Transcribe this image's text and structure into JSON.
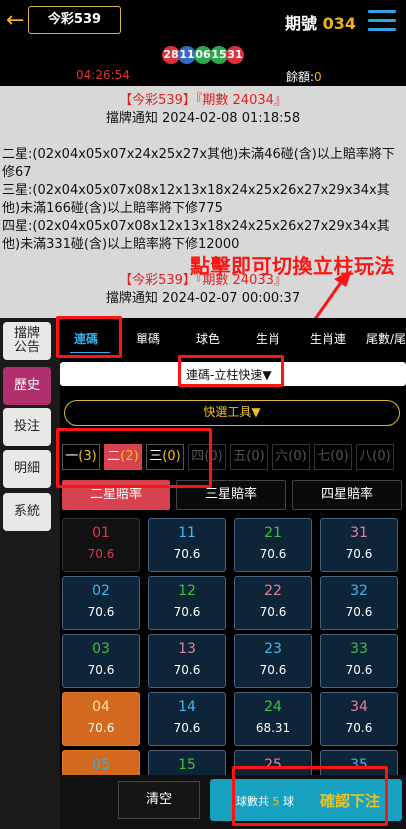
{
  "header": {
    "back_icon": "back-arrow-icon",
    "lottery_name": "今彩539",
    "period_label": "期號",
    "period_number": "034",
    "menu_icon": "hamburger-menu-icon"
  },
  "balls": [
    {
      "n": "28",
      "color": "#e0303a"
    },
    {
      "n": "11",
      "color": "#3668c8"
    },
    {
      "n": "06",
      "color": "#2aa84a"
    },
    {
      "n": "15",
      "color": "#2aa84a"
    },
    {
      "n": "31",
      "color": "#e0303a"
    }
  ],
  "info": {
    "countdown": "04:26:54",
    "balance_label": "餘額:",
    "balance_value": "0"
  },
  "notice": {
    "title1": "【今彩539】『期數 24034』",
    "sub1": "擋牌通知 2024-02-08 01:18:58",
    "line1": "二星:(02x04x05x07x24x25x27x其他)未滿46碰(含)以上賠率將下修67",
    "line2": "三星:(02x04x05x07x08x12x13x18x24x25x26x27x29x34x其他)未滿166碰(含)以上賠率將下修775",
    "line3": "四星:(02x04x05x07x08x12x13x18x24x25x26x27x29x34x其他)未滿331碰(含)以上賠率將下修12000",
    "title2": "【今彩539】『期數 24033』",
    "sub2": "擋牌通知 2024-02-07 00:00:37"
  },
  "annotation": {
    "text": "點擊即可切換立柱玩法"
  },
  "sidebar": [
    {
      "label": "擋牌\n公告",
      "active": false
    },
    {
      "label": "歷史",
      "active": true
    },
    {
      "label": "投注",
      "active": false
    },
    {
      "label": "明細",
      "active": false
    },
    {
      "label": "系統",
      "active": false
    }
  ],
  "tabs": [
    "連碼",
    "單碼",
    "球色",
    "生肖",
    "生肖連",
    "尾數/尾"
  ],
  "play_select": "連碼-立柱快速▼",
  "quick_tools": "快選工具▼",
  "num_tabs": [
    {
      "label": "一",
      "count": "(3)",
      "state": "normal"
    },
    {
      "label": "二",
      "count": "(2)",
      "state": "sel"
    },
    {
      "label": "三",
      "count": "(0)",
      "state": "normal"
    },
    {
      "label": "四",
      "count": "(0)",
      "state": "dis"
    },
    {
      "label": "五",
      "count": "(0)",
      "state": "dis"
    },
    {
      "label": "六",
      "count": "(0)",
      "state": "dis"
    },
    {
      "label": "七",
      "count": "(0)",
      "state": "dis"
    },
    {
      "label": "八",
      "count": "(0)",
      "state": "dis"
    }
  ],
  "rate_tabs": [
    "二星賠率",
    "三星賠率",
    "四星賠率"
  ],
  "grid": [
    {
      "n": "01",
      "o": "70.6",
      "style": "red"
    },
    {
      "n": "11",
      "o": "70.6",
      "style": "blue"
    },
    {
      "n": "21",
      "o": "70.6",
      "style": "green"
    },
    {
      "n": "31",
      "o": "70.6",
      "style": "pink"
    },
    {
      "n": "02",
      "o": "70.6",
      "style": "blue"
    },
    {
      "n": "12",
      "o": "70.6",
      "style": "green"
    },
    {
      "n": "22",
      "o": "70.6",
      "style": "pink"
    },
    {
      "n": "32",
      "o": "70.6",
      "style": "blue"
    },
    {
      "n": "03",
      "o": "70.6",
      "style": "green"
    },
    {
      "n": "13",
      "o": "70.6",
      "style": "pink"
    },
    {
      "n": "23",
      "o": "70.6",
      "style": "blue"
    },
    {
      "n": "33",
      "o": "70.6",
      "style": "green"
    },
    {
      "n": "04",
      "o": "70.6",
      "style": "sel"
    },
    {
      "n": "14",
      "o": "70.6",
      "style": "blue"
    },
    {
      "n": "24",
      "o": "68.31",
      "style": "green"
    },
    {
      "n": "34",
      "o": "70.6",
      "style": "pink"
    },
    {
      "n": "05",
      "o": "",
      "style": "orange"
    },
    {
      "n": "15",
      "o": "",
      "style": "green"
    },
    {
      "n": "25",
      "o": "",
      "style": "pink"
    },
    {
      "n": "35",
      "o": "",
      "style": "blue"
    }
  ],
  "bottom": {
    "clear": "清空",
    "count_label": "球數共",
    "count_value": "5",
    "count_unit": "球",
    "confirm": "確認下注"
  }
}
